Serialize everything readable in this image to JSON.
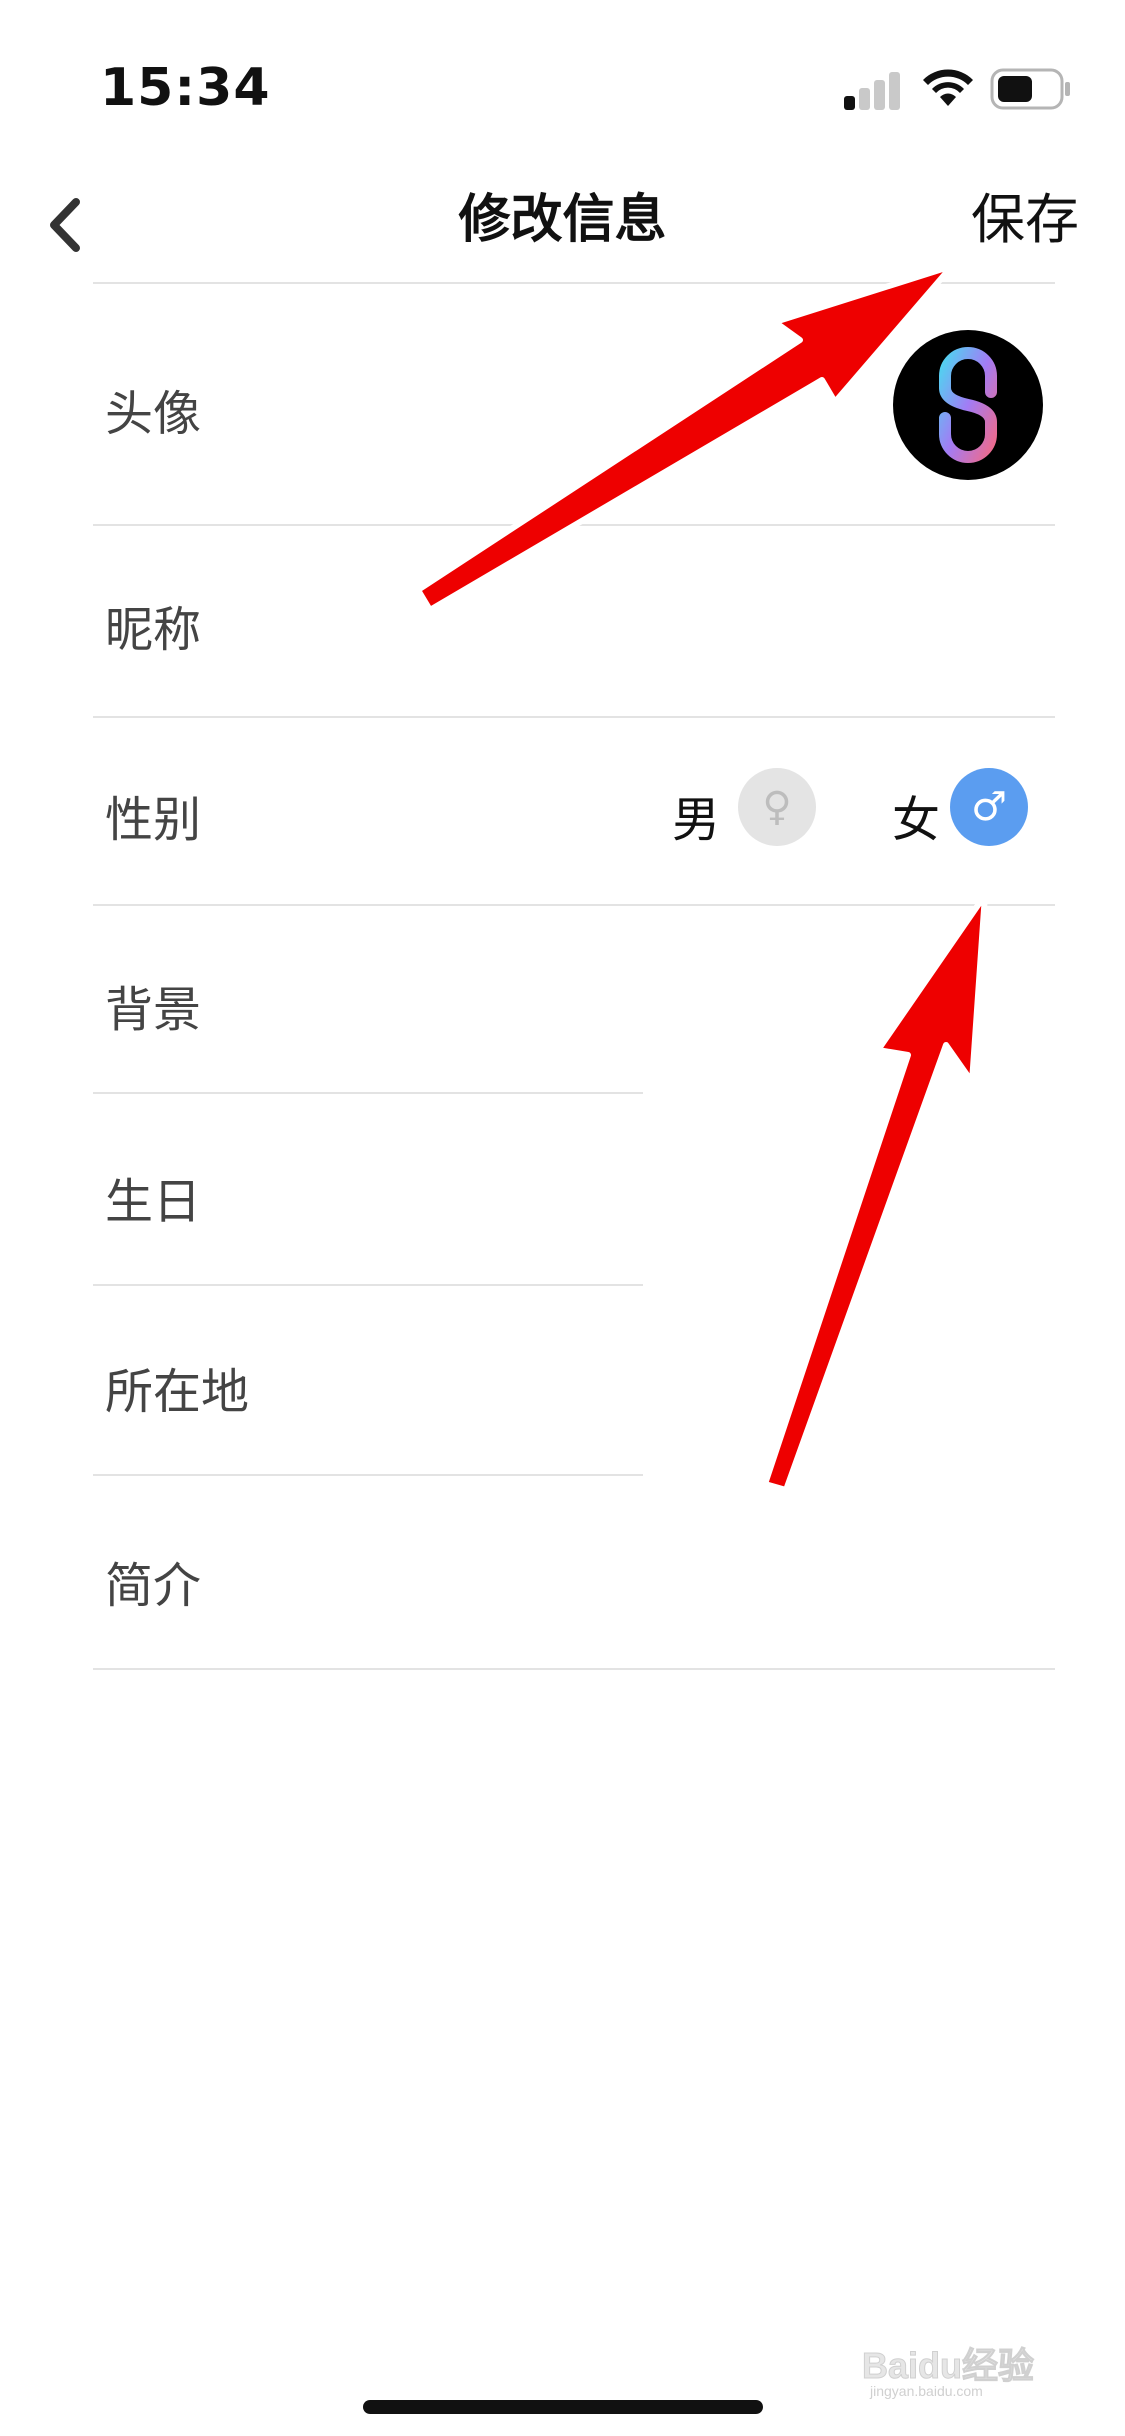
{
  "status_bar": {
    "time": "15:34"
  },
  "nav": {
    "title": "修改信息",
    "save_label": "保存"
  },
  "rows": {
    "avatar_label": "头像",
    "nickname_label": "昵称",
    "gender_label": "性别",
    "background_label": "背景",
    "birthday_label": "生日",
    "location_label": "所在地",
    "bio_label": "简介"
  },
  "gender": {
    "male_label": "男",
    "male_icon": "♀",
    "female_label": "女",
    "female_icon": "♂",
    "selected": "女"
  },
  "colors": {
    "selected_gender": "#5b9df0",
    "unselected_gender": "#e4e4e4",
    "annotation_arrow": "#ee0000"
  },
  "watermark": {
    "text": "Baidu经验",
    "url_text": "jingyan.baidu.com"
  }
}
